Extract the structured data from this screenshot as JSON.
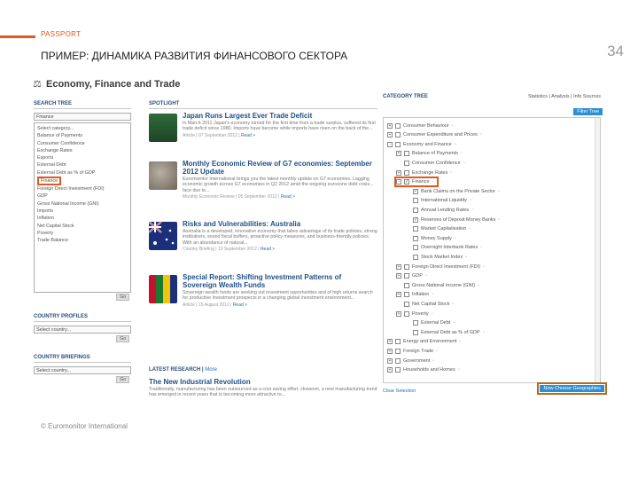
{
  "slide": {
    "section": "PASSPORT",
    "title": "ПРИМЕР: ДИНАМИКА РАЗВИТИЯ ФИНАНСОВОГО СЕКТОРА",
    "page_number": "34",
    "footer": "© Euromonitor International"
  },
  "app": {
    "title": "Economy, Finance and Trade",
    "search_tree": {
      "title": "SEARCH TREE",
      "selected": "Finance",
      "options": [
        "Select category...",
        "Balance of Payments",
        "Consumer Confidence",
        "Exchange Rates",
        "Exports",
        "External Debt",
        "External Debt as % of GDP",
        "Finance",
        "Foreign Direct Investment (FDI)",
        "GDP",
        "Gross National Income (GNI)",
        "Imports",
        "Inflation",
        "Net Capital Stock",
        "Poverty",
        "Trade Balance"
      ],
      "go_label": "Go"
    },
    "country_profiles": {
      "title": "COUNTRY PROFILES",
      "placeholder": "Select country...",
      "go_label": "Go"
    },
    "country_briefings": {
      "title": "COUNTRY BRIEFINGS",
      "placeholder": "Select country...",
      "go_label": "Go"
    },
    "spotlight": {
      "title": "SPOTLIGHT",
      "articles": [
        {
          "title": "Japan Runs Largest Ever Trade Deficit",
          "desc": "In March 2011 Japan's economy turned for the first time from a trade surplus, suffered its first trade deficit since 1980. Imports have become while imports have risen on the back of the...",
          "meta": "Article | 07 September 2012 |",
          "read": "Read >"
        },
        {
          "title": "Monthly Economic Review of G7 economies: September 2012 Update",
          "desc": "Euromonitor International brings you the latest monthly update on G7 economies. Lagging economic growth across G7 economies in Q2 2012 amid the ongoing eurozone debt crisis... face due to...",
          "meta": "Monthly Economic Review | 05 September 2012 |",
          "read": "Read >"
        },
        {
          "title": "Risks and Vulnerabilities: Australia",
          "desc": "Australia is a developed, innovative economy that takes advantage of its trade policies, strong institutions, sound fiscal buffers, proactive policy measures, and business-friendly policies. With an abundance of natural...",
          "meta": "Country Briefing | 10 September 2012 |",
          "read": "Read >"
        },
        {
          "title": "Special Report: Shifting Investment Patterns of Sovereign Wealth Funds",
          "desc": "Sovereign wealth funds are seeking out investment opportunities and of high returns search for productive investment prospects in a changing global investment environment...",
          "meta": "Article | 15 August 2012 |",
          "read": "Read >"
        }
      ]
    },
    "latest_research": {
      "title": "LATEST RESEARCH",
      "more": "More",
      "article_title": "The New Industrial Revolution",
      "article_desc": "Traditionally, manufacturing has been outsourced as a cost saving effort. However, a new manufacturing trend has emerged in recent years that is becoming more attractive to..."
    },
    "category_tree": {
      "title": "CATEGORY TREE",
      "links": "Statistics | Analysis | Info Sources",
      "filter_label": "Filter Tree",
      "rows": [
        {
          "label": "Consumer Behaviour",
          "indent": 1,
          "toggle": "+",
          "checked": false
        },
        {
          "label": "Consumer Expenditure and Prices",
          "indent": 1,
          "toggle": "+",
          "checked": false
        },
        {
          "label": "Economy and Finance",
          "indent": 1,
          "toggle": "-",
          "checked": false
        },
        {
          "label": "Balance of Payments",
          "indent": 2,
          "toggle": "+",
          "checked": false
        },
        {
          "label": "Consumer Confidence",
          "indent": 2,
          "toggle": "",
          "checked": false
        },
        {
          "label": "Exchange Rates",
          "indent": 2,
          "toggle": "+",
          "checked": false
        },
        {
          "label": "Finance",
          "indent": 2,
          "toggle": "-",
          "checked": true
        },
        {
          "label": "Bank Claims on the Private Sector",
          "indent": 3,
          "toggle": "",
          "checked": true
        },
        {
          "label": "International Liquidity",
          "indent": 3,
          "toggle": "",
          "checked": false
        },
        {
          "label": "Annual Lending Rates",
          "indent": 3,
          "toggle": "",
          "checked": false
        },
        {
          "label": "Reserves of Deposit Money Banks",
          "indent": 3,
          "toggle": "",
          "checked": true
        },
        {
          "label": "Market Capitalisation",
          "indent": 3,
          "toggle": "",
          "checked": false
        },
        {
          "label": "Money Supply",
          "indent": 3,
          "toggle": "",
          "checked": false
        },
        {
          "label": "Overnight Interbank Rates",
          "indent": 3,
          "toggle": "",
          "checked": false
        },
        {
          "label": "Stock Market Index",
          "indent": 3,
          "toggle": "",
          "checked": false
        },
        {
          "label": "Foreign Direct Investment (FDI)",
          "indent": 2,
          "toggle": "+",
          "checked": false
        },
        {
          "label": "GDP",
          "indent": 2,
          "toggle": "+",
          "checked": false
        },
        {
          "label": "Gross National Income (GNI)",
          "indent": 2,
          "toggle": "",
          "checked": false
        },
        {
          "label": "Inflation",
          "indent": 2,
          "toggle": "+",
          "checked": false
        },
        {
          "label": "Net Capital Stock",
          "indent": 2,
          "toggle": "",
          "checked": false
        },
        {
          "label": "Poverty",
          "indent": 2,
          "toggle": "+",
          "checked": false
        },
        {
          "label": "External Debt",
          "indent": 3,
          "toggle": "",
          "checked": false
        },
        {
          "label": "External Debt as % of GDP",
          "indent": 3,
          "toggle": "",
          "checked": false
        },
        {
          "label": "Energy and Environment",
          "indent": 1,
          "toggle": "+",
          "checked": false
        },
        {
          "label": "Foreign Trade",
          "indent": 1,
          "toggle": "+",
          "checked": false
        },
        {
          "label": "Government",
          "indent": 1,
          "toggle": "+",
          "checked": false
        },
        {
          "label": "Households and Homes",
          "indent": 1,
          "toggle": "+",
          "checked": false
        }
      ],
      "clear_label": "Clear Selection",
      "choose_label": "Now Choose Geographies"
    }
  }
}
